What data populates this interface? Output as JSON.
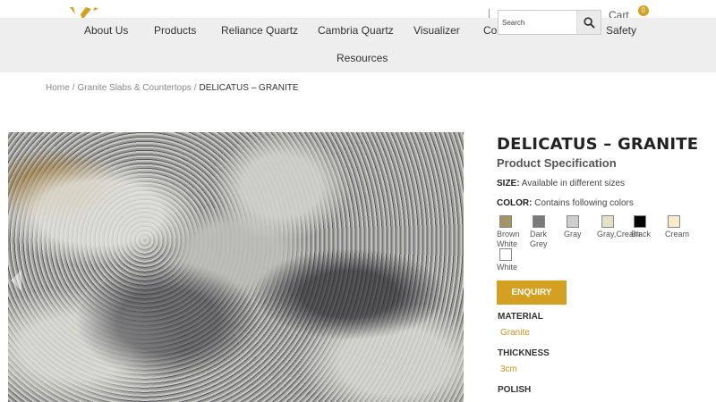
{
  "header": {
    "cart_label": "Cart",
    "cart_count": "0",
    "search_placeholder": "Search"
  },
  "nav": {
    "items": [
      "About Us",
      "Products",
      "Reliance Quartz",
      "Cambria Quartz",
      "Visualizer",
      "Contact",
      "Safety",
      "Resources"
    ]
  },
  "breadcrumb": {
    "home": "Home",
    "category": "Granite Slabs & Countertops",
    "current": "DELICATUS – GRANITE",
    "separator": "/"
  },
  "product": {
    "title": "DELICATUS – GRANITE",
    "subtitle": "Product Specification",
    "size_label": "SIZE:",
    "size_value": "Available in different sizes",
    "color_label": "COLOR:",
    "color_value": "Contains following colors",
    "colors": [
      {
        "name": "Brown White",
        "line1": "Brown",
        "line2": "White",
        "hex": "#a39468"
      },
      {
        "name": "Dark Grey",
        "line1": "Dark",
        "line2": "Grey",
        "hex": "#7a7a7a"
      },
      {
        "name": "Gray",
        "line1": "Gray",
        "line2": "",
        "hex": "#cfcfcf"
      },
      {
        "name": "Gray,Cream",
        "line1": "Gray,Cream",
        "line2": "",
        "hex": "#e3e2c9"
      },
      {
        "name": "Black",
        "line1": "Black",
        "line2": "",
        "hex": "#050505"
      },
      {
        "name": "Cream",
        "line1": "Cream",
        "line2": "",
        "hex": "#f6ecc9"
      },
      {
        "name": "White",
        "line1": "White",
        "line2": "",
        "hex": "#ffffff"
      }
    ],
    "enquiry_label": "ENQUIRY",
    "material_label": "MATERIAL",
    "material_value": "Granite",
    "thickness_label": "THICKNESS",
    "thickness_value": "3cm",
    "polish_label": "POLISH"
  },
  "colors": {
    "accent": "#d4a021",
    "nav_bg": "#eeeeee"
  }
}
